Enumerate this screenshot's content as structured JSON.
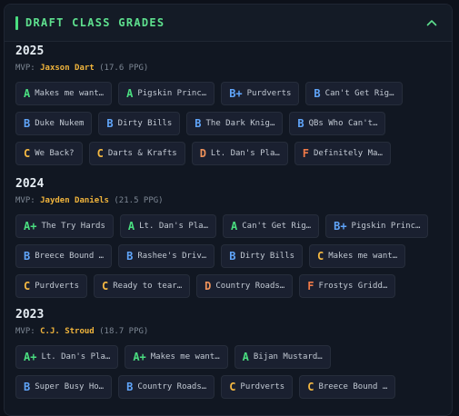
{
  "panel": {
    "title": "DRAFT CLASS GRADES"
  },
  "seasons": [
    {
      "year": "2025",
      "mvp_label": "MVP:",
      "mvp_name": "Jaxson Dart",
      "mvp_stat": "(17.6 PPG)",
      "rows": [
        [
          {
            "grade": "A",
            "team": "Makes me want…"
          },
          {
            "grade": "A",
            "team": "Pigskin Princ…"
          },
          {
            "grade": "B+",
            "team": "Purdverts"
          },
          {
            "grade": "B",
            "team": "Can't Get Rig…"
          }
        ],
        [
          {
            "grade": "B",
            "team": "Duke Nukem"
          },
          {
            "grade": "B",
            "team": "Dirty Bills"
          },
          {
            "grade": "B",
            "team": "The Dark Knig…"
          },
          {
            "grade": "B",
            "team": "QBs Who Can't…"
          }
        ],
        [
          {
            "grade": "C",
            "team": "We Back?"
          },
          {
            "grade": "C",
            "team": "Darts & Krafts"
          },
          {
            "grade": "D",
            "team": "Lt. Dan's Pla…"
          },
          {
            "grade": "F",
            "team": "Definitely Ma…"
          }
        ]
      ]
    },
    {
      "year": "2024",
      "mvp_label": "MVP:",
      "mvp_name": "Jayden Daniels",
      "mvp_stat": "(21.5 PPG)",
      "rows": [
        [
          {
            "grade": "A+",
            "team": "The Try Hards"
          },
          {
            "grade": "A",
            "team": "Lt. Dan's Pla…"
          },
          {
            "grade": "A",
            "team": "Can't Get Rig…"
          },
          {
            "grade": "B+",
            "team": "Pigskin Princ…"
          }
        ],
        [
          {
            "grade": "B",
            "team": "Breece Bound …"
          },
          {
            "grade": "B",
            "team": "Rashee's Driv…"
          },
          {
            "grade": "B",
            "team": "Dirty Bills"
          },
          {
            "grade": "C",
            "team": "Makes me want…"
          }
        ],
        [
          {
            "grade": "C",
            "team": "Purdverts"
          },
          {
            "grade": "C",
            "team": "Ready to tear…"
          },
          {
            "grade": "D",
            "team": "Country Roads…"
          },
          {
            "grade": "F",
            "team": "Frostys Gridd…"
          }
        ]
      ]
    },
    {
      "year": "2023",
      "mvp_label": "MVP:",
      "mvp_name": "C.J. Stroud",
      "mvp_stat": "(18.7 PPG)",
      "rows": [
        [
          {
            "grade": "A+",
            "team": "Lt. Dan's Pla…"
          },
          {
            "grade": "A+",
            "team": "Makes me want…"
          },
          {
            "grade": "A",
            "team": "Bijan Mustard…"
          }
        ],
        [
          {
            "grade": "B",
            "team": "Super Busy Ho…"
          },
          {
            "grade": "B",
            "team": "Country Roads…"
          },
          {
            "grade": "C",
            "team": "Purdverts"
          },
          {
            "grade": "C",
            "team": "Breece Bound …"
          }
        ]
      ]
    }
  ],
  "grade_colors": {
    "A": "#4ade80",
    "B": "#60a5fa",
    "C": "#f5b942",
    "D": "#f0925a",
    "F": "#f07a48"
  },
  "icons": {
    "collapse": "chevron-up-icon"
  }
}
